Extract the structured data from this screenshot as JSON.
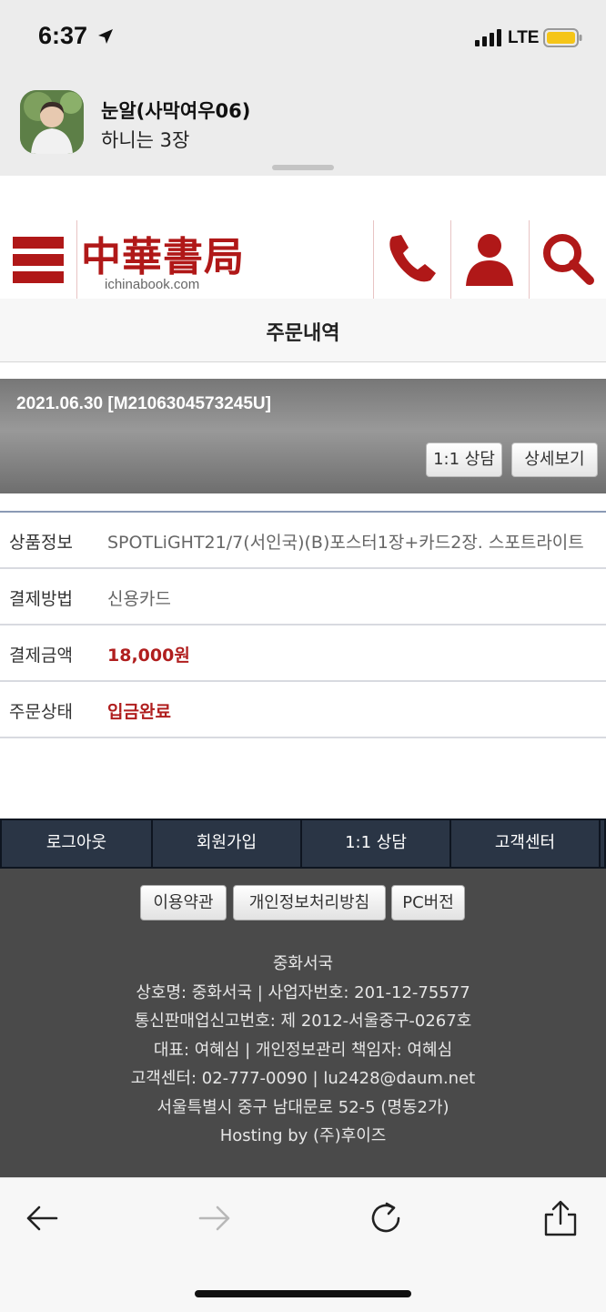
{
  "status_bar": {
    "time": "6:37",
    "network": "LTE",
    "battery_color": "#f5c518"
  },
  "notification": {
    "sender": "눈알(사막여우06)",
    "message": "하니는 3장"
  },
  "site": {
    "logo_cn": "中華書局",
    "logo_url": "ichinabook.com",
    "brand_color": "#b01818"
  },
  "page": {
    "title": "주문내역"
  },
  "order": {
    "id_line": "2021.06.30 [M2106304573245U]",
    "chat_button": "1:1 상담",
    "detail_button": "상세보기"
  },
  "info_rows": [
    {
      "label": "상품정보",
      "value": "SPOTLiGHT21/7(서인국)(B)포스터1장+카드2장. 스포트라이트"
    },
    {
      "label": "결제방법",
      "value": "신용카드"
    },
    {
      "label": "결제금액",
      "value": "18,000원"
    },
    {
      "label": "주문상태",
      "value": "입금완료"
    }
  ],
  "footer_nav": [
    "로그아웃",
    "회원가입",
    "1:1 상담",
    "고객센터"
  ],
  "footer_buttons": [
    "이용약관",
    "개인정보처리방침",
    "PC버전"
  ],
  "footer_lines": [
    "중화서국",
    "상호명: 중화서국 | 사업자번호: 201-12-75577",
    "통신판매업신고번호: 제 2012-서울중구-0267호",
    "대표: 여혜심 | 개인정보관리 책임자: 여혜심",
    "고객센터: 02-777-0090 | lu2428@daum.net",
    "서울특별시 중구 남대문로 52-5 (명동2가)",
    "Hosting by (주)후이즈"
  ],
  "browser_icons": [
    "back-arrow-icon",
    "forward-arrow-icon",
    "reload-icon",
    "share-icon"
  ]
}
